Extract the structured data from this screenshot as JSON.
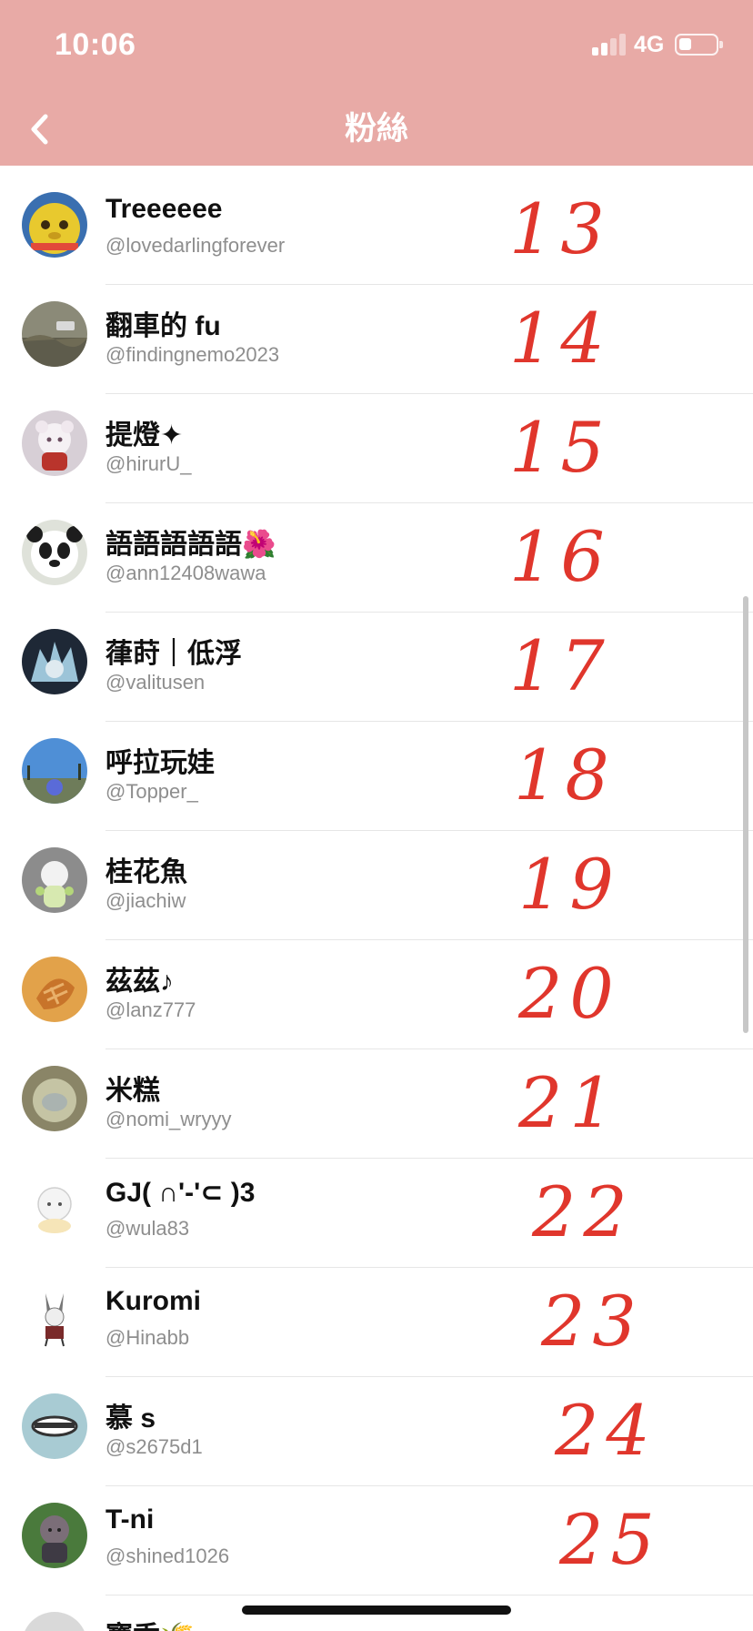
{
  "status_bar": {
    "time": "10:06",
    "network": "4G",
    "signal_bars": 2,
    "battery_level": 0.35
  },
  "header": {
    "title": "粉絲",
    "background_color": "#e8aaa6",
    "back_icon": "chevron-left-icon"
  },
  "annotation_color": "#e0362c",
  "followers": [
    {
      "name": "Treeeeee",
      "handle": "@lovedarlingforever",
      "annotation": "13"
    },
    {
      "name": "翻車的 fu",
      "handle": "@findingnemo2023",
      "annotation": "14"
    },
    {
      "name": "提燈✦",
      "handle": "@hirurU_",
      "annotation": "15"
    },
    {
      "name": "語語語語語🌺",
      "handle": "@ann12408wawa",
      "annotation": "16"
    },
    {
      "name": "葎莳｜低浮",
      "handle": "@valitusen",
      "annotation": "17"
    },
    {
      "name": "呼拉玩娃",
      "handle": "@Topper_",
      "annotation": "18"
    },
    {
      "name": "桂花魚",
      "handle": "@jiachiw",
      "annotation": "19"
    },
    {
      "name": "茲茲♪",
      "handle": "@lanz777",
      "annotation": "20"
    },
    {
      "name": "米糕",
      "handle": "@nomi_wryyy",
      "annotation": "21"
    },
    {
      "name": "GJ( ∩'-'⊂ )3",
      "handle": "@wula83",
      "annotation": "22"
    },
    {
      "name": "Kuromi",
      "handle": "@Hinabb",
      "annotation": "23"
    },
    {
      "name": "慕 s",
      "handle": "@s2675d1",
      "annotation": "24"
    },
    {
      "name": "T-ni",
      "handle": "@shined1026",
      "annotation": "25"
    }
  ],
  "partial_follower": {
    "name": "寶香🌾"
  }
}
